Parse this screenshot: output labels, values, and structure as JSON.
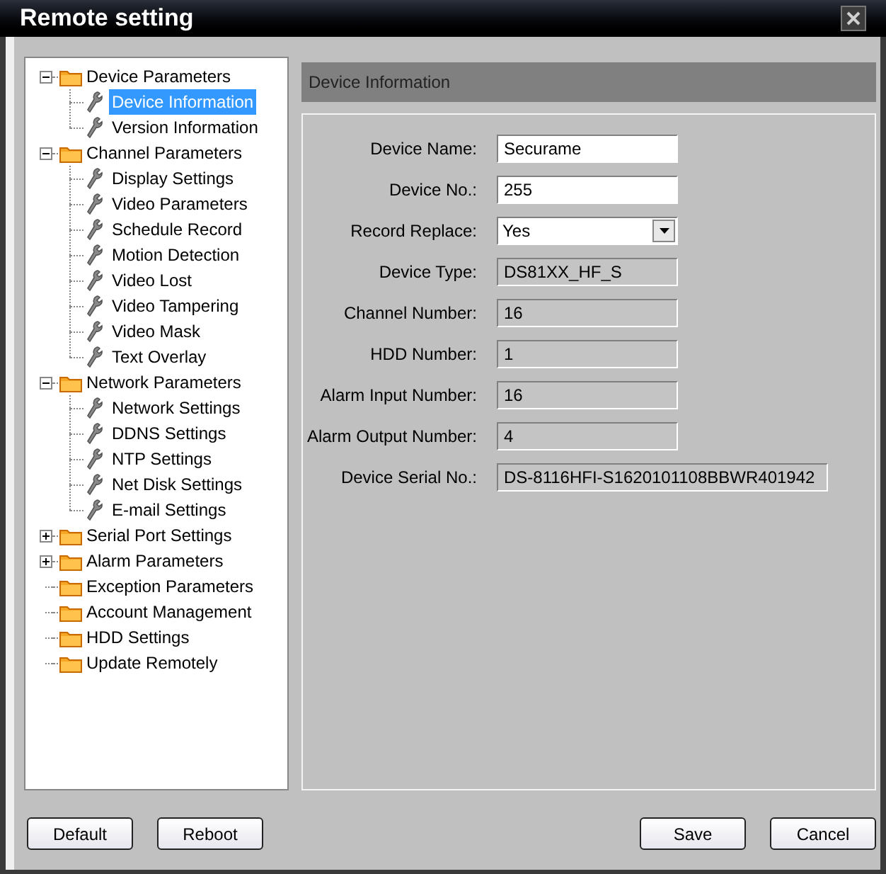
{
  "window": {
    "title": "Remote setting"
  },
  "tree": [
    {
      "label": "Device Parameters",
      "expanded": true,
      "children": [
        {
          "label": "Device Information",
          "selected": true
        },
        {
          "label": "Version Information",
          "selected": false
        }
      ]
    },
    {
      "label": "Channel Parameters",
      "expanded": true,
      "children": [
        {
          "label": "Display Settings",
          "selected": false
        },
        {
          "label": "Video Parameters",
          "selected": false
        },
        {
          "label": "Schedule Record",
          "selected": false
        },
        {
          "label": "Motion Detection",
          "selected": false
        },
        {
          "label": "Video Lost",
          "selected": false
        },
        {
          "label": "Video Tampering",
          "selected": false
        },
        {
          "label": "Video Mask",
          "selected": false
        },
        {
          "label": "Text Overlay",
          "selected": false
        }
      ]
    },
    {
      "label": "Network Parameters",
      "expanded": true,
      "children": [
        {
          "label": "Network Settings",
          "selected": false
        },
        {
          "label": "DDNS Settings",
          "selected": false
        },
        {
          "label": "NTP Settings",
          "selected": false
        },
        {
          "label": "Net Disk Settings",
          "selected": false
        },
        {
          "label": "E-mail Settings",
          "selected": false
        }
      ]
    },
    {
      "label": "Serial Port Settings",
      "expanded": false
    },
    {
      "label": "Alarm Parameters",
      "expanded": false
    },
    {
      "label": "Exception Parameters"
    },
    {
      "label": "Account Management"
    },
    {
      "label": "HDD Settings"
    },
    {
      "label": "Update Remotely"
    }
  ],
  "panel": {
    "title": "Device Information",
    "fields": [
      {
        "label": "Device Name:",
        "kind": "text",
        "value": "Securame"
      },
      {
        "label": "Device No.:",
        "kind": "text",
        "value": "255"
      },
      {
        "label": "Record Replace:",
        "kind": "select",
        "value": "Yes"
      },
      {
        "label": "Device Type:",
        "kind": "readonly",
        "value": "DS81XX_HF_S"
      },
      {
        "label": "Channel Number:",
        "kind": "readonly",
        "value": "16"
      },
      {
        "label": "HDD Number:",
        "kind": "readonly",
        "value": "1"
      },
      {
        "label": "Alarm Input Number:",
        "kind": "readonly",
        "value": "16"
      },
      {
        "label": "Alarm Output Number:",
        "kind": "readonly",
        "value": "4"
      },
      {
        "label": "Device Serial No.:",
        "kind": "wide",
        "value": "DS-8116HFI-S1620101108BBWR401942"
      }
    ]
  },
  "buttons_left": [
    "Default",
    "Reboot"
  ],
  "buttons_right": [
    "Save",
    "Cancel"
  ]
}
